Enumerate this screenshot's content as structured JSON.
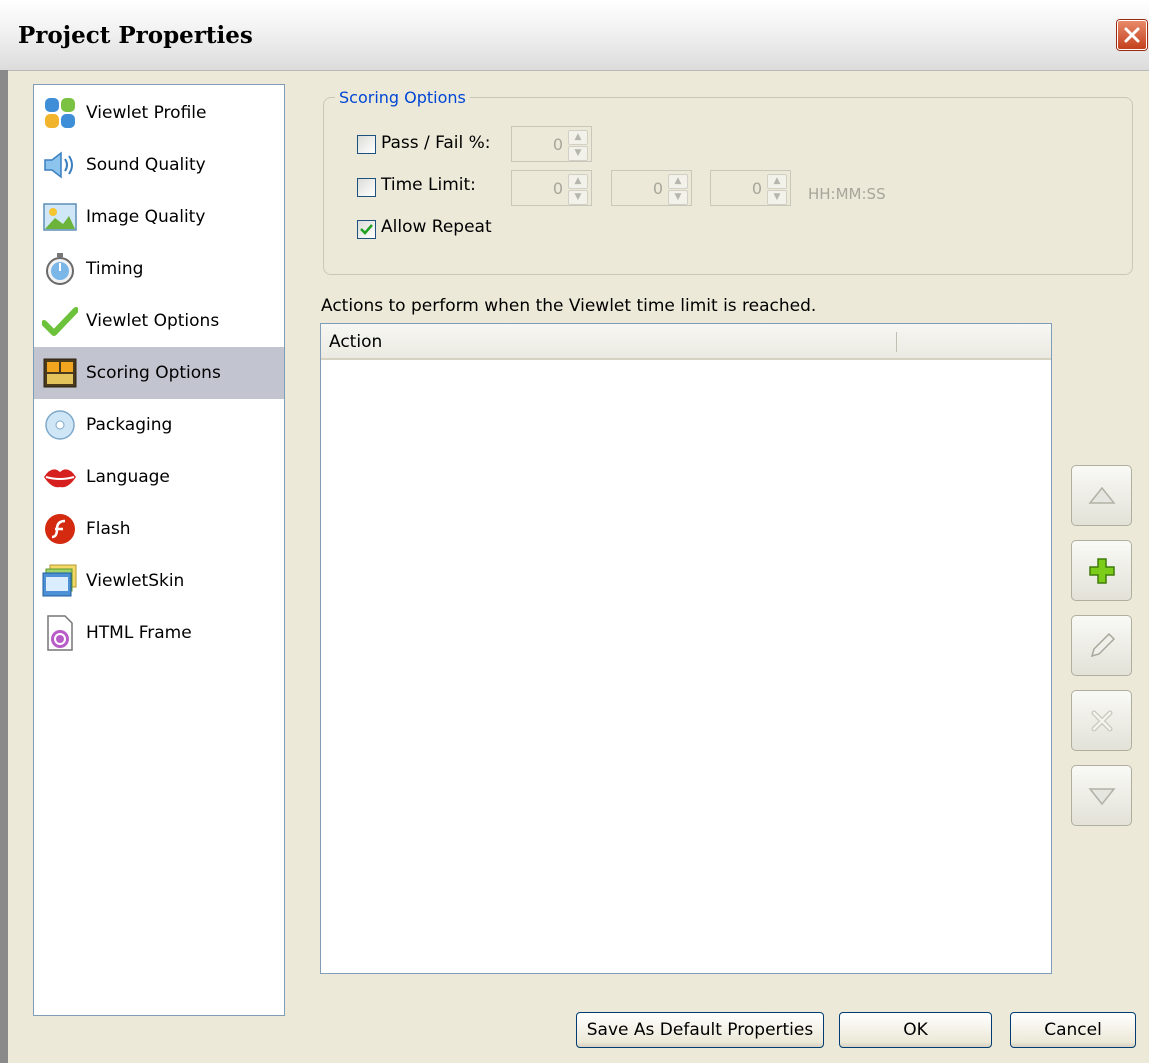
{
  "window": {
    "title": "Project Properties"
  },
  "sidebar": {
    "items": [
      {
        "label": "Viewlet Profile",
        "icon": "profile-icon"
      },
      {
        "label": "Sound Quality",
        "icon": "speaker-icon"
      },
      {
        "label": "Image Quality",
        "icon": "image-icon"
      },
      {
        "label": "Timing",
        "icon": "stopwatch-icon"
      },
      {
        "label": "Viewlet Options",
        "icon": "checkmark-icon"
      },
      {
        "label": "Scoring Options",
        "icon": "scoreboard-icon",
        "selected": true
      },
      {
        "label": "Packaging",
        "icon": "disc-icon"
      },
      {
        "label": "Language",
        "icon": "lips-icon"
      },
      {
        "label": "Flash",
        "icon": "flash-icon"
      },
      {
        "label": "ViewletSkin",
        "icon": "skin-icon"
      },
      {
        "label": "HTML Frame",
        "icon": "html-frame-icon"
      }
    ]
  },
  "scoring": {
    "legend": "Scoring Options",
    "pass_fail": {
      "label": "Pass / Fail %:",
      "checked": false,
      "value": "0"
    },
    "time_limit": {
      "label": "Time Limit:",
      "checked": false,
      "hours": "0",
      "minutes": "0",
      "seconds": "0",
      "format_hint": "HH:MM:SS"
    },
    "allow_repeat": {
      "label": "Allow Repeat",
      "checked": true
    }
  },
  "actions": {
    "caption": "Actions to perform when the Viewlet time limit is reached.",
    "columns": [
      "Action"
    ],
    "rows": []
  },
  "footer": {
    "save_default": "Save As Default Properties",
    "ok": "OK",
    "cancel": "Cancel"
  },
  "colors": {
    "legend": "#0046d5",
    "selected": "#c2c4d0",
    "add_green": "#7ccc1a"
  }
}
